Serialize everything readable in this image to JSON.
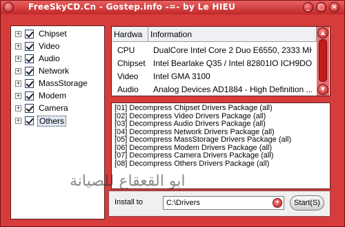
{
  "window": {
    "title": "FreeSkyCD.Cn - Gostep.info -=- by Le HIEU",
    "minimize_glyph": "_",
    "maximize_glyph": "□",
    "close_glyph": "×"
  },
  "tree": {
    "expand_glyph": "+",
    "items": [
      {
        "label": "Chipset",
        "checked": true
      },
      {
        "label": "Video",
        "checked": true
      },
      {
        "label": "Audio",
        "checked": true
      },
      {
        "label": "Network",
        "checked": true
      },
      {
        "label": "MassStorage",
        "checked": true
      },
      {
        "label": "Modem",
        "checked": true
      },
      {
        "label": "Camera",
        "checked": true
      },
      {
        "label": "Others",
        "checked": true,
        "selected": true
      }
    ]
  },
  "hardware_table": {
    "columns": [
      "Hardwa",
      "Information"
    ],
    "rows": [
      {
        "hardware": "CPU",
        "information": "DualCore Intel Core 2 Duo E6550, 2333 MH..."
      },
      {
        "hardware": "Chipset",
        "information": "Intel Bearlake Q35 / Intel 82801IO ICH9DO"
      },
      {
        "hardware": "Video",
        "information": "Intel GMA 3100"
      },
      {
        "hardware": "Audio",
        "information": "Analog Devices AD1884  - High Definition ..."
      }
    ],
    "scroll_up_glyph": "▲",
    "scroll_down_glyph": "▼"
  },
  "log": {
    "lines": [
      "[01] Decompress Chipset Drivers Package (all)",
      "[02] Decompress Video Drivers Package (all)",
      "[03] Decompress Audio Drivers Package (all)",
      "[04] Decompress Network Drivers Package (all)",
      "[05] Decompress MassStorage Drivers Package (all)",
      "[06] Decompress Modem Drivers Package (all)",
      "[07] Decompress Camera Drivers Package (all)",
      "[08] Decompress Others Drivers Package (all)"
    ],
    "watermark": "ابو القعقاع للصيانة"
  },
  "install": {
    "label": "Install to",
    "path": "C:\\Drivers",
    "dropdown_glyph": "▼",
    "start_label": "Start(S)"
  },
  "colors": {
    "accent": "#d63c3c",
    "title_text": "#ffffff"
  }
}
